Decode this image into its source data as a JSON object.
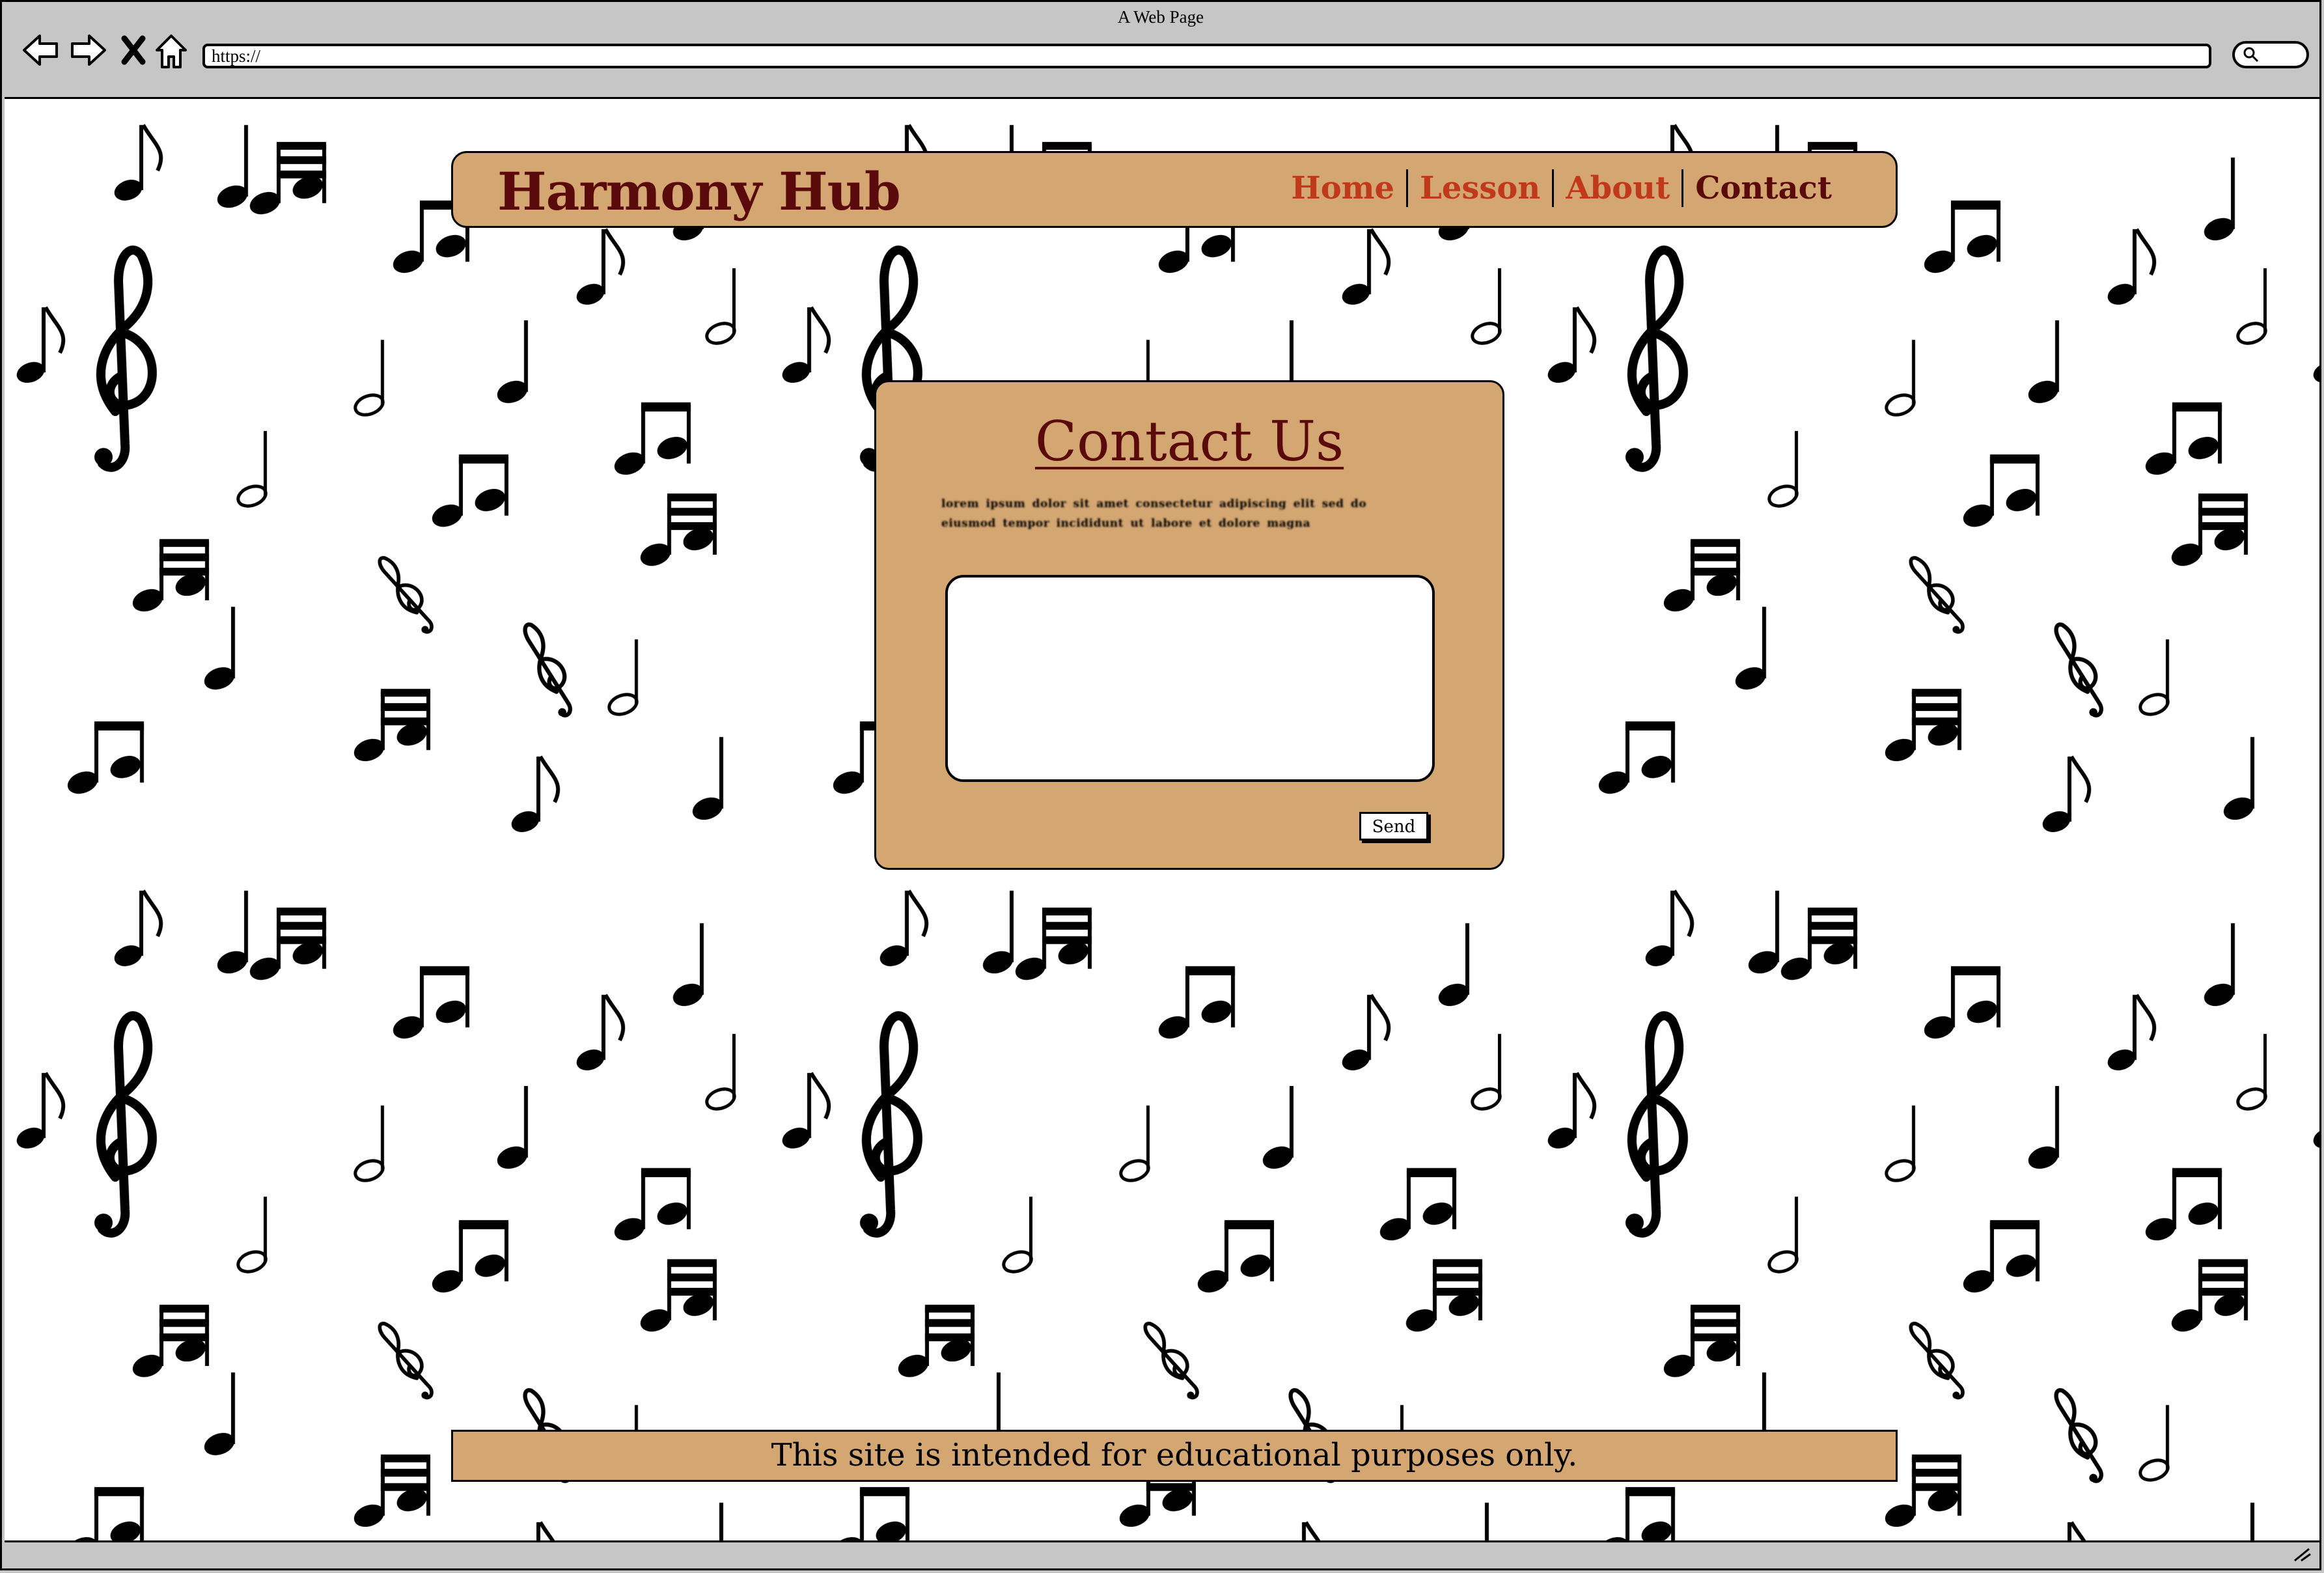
{
  "browser": {
    "window_title": "A Web Page",
    "url": "https://",
    "icons": [
      "back-arrow-icon",
      "forward-arrow-icon",
      "close-x-icon",
      "home-icon",
      "search-icon",
      "resize-grip-icon"
    ]
  },
  "header": {
    "site_title": "Harmony Hub",
    "nav": [
      {
        "label": "Home",
        "active": false
      },
      {
        "label": "Lesson",
        "active": false
      },
      {
        "label": "About",
        "active": false
      },
      {
        "label": "Contact",
        "active": true
      }
    ]
  },
  "contact": {
    "title": "Contact Us",
    "blurb": "lorem ipsum dolor sit amet consectetur adipiscing elit sed do eiusmod tempor incididunt ut labore et dolore magna",
    "message_value": "",
    "send_label": "Send"
  },
  "footer": {
    "text": "This site is intended for educational purposes only."
  },
  "colors": {
    "panel": "#d4a672",
    "title": "#5a0a0a",
    "nav_link": "#c0391b",
    "chrome": "#c6c6c6"
  }
}
